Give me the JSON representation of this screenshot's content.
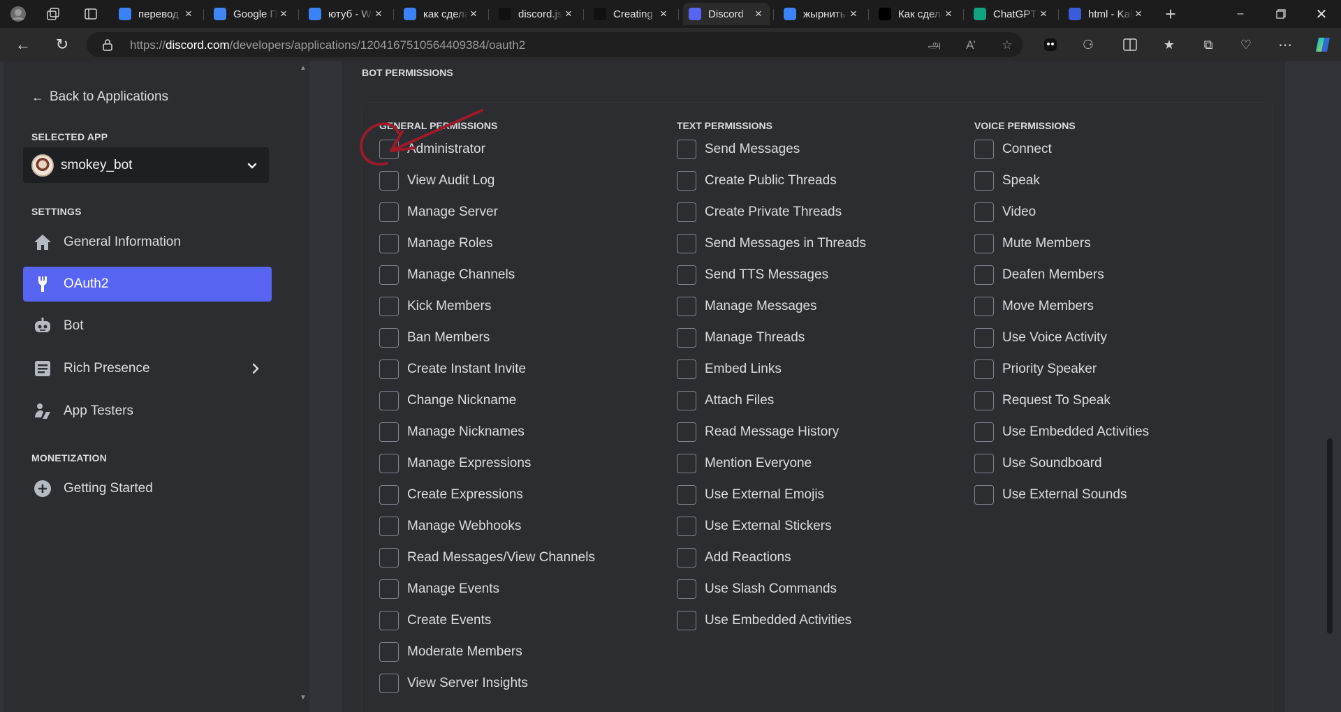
{
  "browser": {
    "tabs": [
      {
        "label": "перевод",
        "favicon": "search-icon",
        "color": "#3b82f6"
      },
      {
        "label": "Google Переводчик",
        "favicon": "google-translate-icon",
        "color": "#4285f4"
      },
      {
        "label": "ютуб - Wordstat",
        "favicon": "search-icon",
        "color": "#3b82f6"
      },
      {
        "label": "как сделать",
        "favicon": "search-icon",
        "color": "#3b82f6"
      },
      {
        "label": "discord.js",
        "favicon": "discordjs-icon",
        "color": "#111111"
      },
      {
        "label": "Creating",
        "favicon": "discordjs-icon",
        "color": "#111111"
      },
      {
        "label": "Discord",
        "favicon": "discord-icon",
        "color": "#5865f2"
      },
      {
        "label": "жырнить",
        "favicon": "search-icon",
        "color": "#3b82f6"
      },
      {
        "label": "Как сделать",
        "favicon": "dtf-icon",
        "color": "#000000"
      },
      {
        "label": "ChatGPT",
        "favicon": "chatgpt-icon",
        "color": "#10a37f"
      },
      {
        "label": "html - Kak",
        "favicon": "stackoverflow-icon",
        "color": "#3b5bdb"
      }
    ],
    "active_tab_index": 6,
    "url_prefix": "https://",
    "url_host": "discord.com",
    "url_path": "/developers/applications/1204167510564409384/oauth2"
  },
  "sidebar": {
    "back_label": "Back to Applications",
    "selected_app_heading": "SELECTED APP",
    "app_name": "smokey_bot",
    "settings_heading": "SETTINGS",
    "items": [
      {
        "label": "General Information",
        "icon": "home-icon",
        "active": false
      },
      {
        "label": "OAuth2",
        "icon": "wrench-icon",
        "active": true
      },
      {
        "label": "Bot",
        "icon": "robot-icon",
        "active": false
      },
      {
        "label": "Rich Presence",
        "icon": "document-icon",
        "active": false
      },
      {
        "label": "App Testers",
        "icon": "person-icon",
        "active": false
      }
    ],
    "monetization_heading": "MONETIZATION",
    "monetization_items": [
      {
        "label": "Getting Started",
        "icon": "plus-circle-icon"
      }
    ]
  },
  "permissions": {
    "section_title": "BOT PERMISSIONS",
    "general": {
      "heading": "GENERAL PERMISSIONS",
      "items": [
        "Administrator",
        "View Audit Log",
        "Manage Server",
        "Manage Roles",
        "Manage Channels",
        "Kick Members",
        "Ban Members",
        "Create Instant Invite",
        "Change Nickname",
        "Manage Nicknames",
        "Manage Expressions",
        "Create Expressions",
        "Manage Webhooks",
        "Read Messages/View Channels",
        "Manage Events",
        "Create Events",
        "Moderate Members",
        "View Server Insights"
      ]
    },
    "text": {
      "heading": "TEXT PERMISSIONS",
      "items": [
        "Send Messages",
        "Create Public Threads",
        "Create Private Threads",
        "Send Messages in Threads",
        "Send TTS Messages",
        "Manage Messages",
        "Manage Threads",
        "Embed Links",
        "Attach Files",
        "Read Message History",
        "Mention Everyone",
        "Use External Emojis",
        "Use External Stickers",
        "Add Reactions",
        "Use Slash Commands",
        "Use Embedded Activities"
      ]
    },
    "voice": {
      "heading": "VOICE PERMISSIONS",
      "items": [
        "Connect",
        "Speak",
        "Video",
        "Mute Members",
        "Deafen Members",
        "Move Members",
        "Use Voice Activity",
        "Priority Speaker",
        "Request To Speak",
        "Use Embedded Activities",
        "Use Soundboard",
        "Use External Sounds"
      ]
    }
  },
  "colors": {
    "accent": "#5865f2",
    "annotation": "#9b1b2a"
  }
}
